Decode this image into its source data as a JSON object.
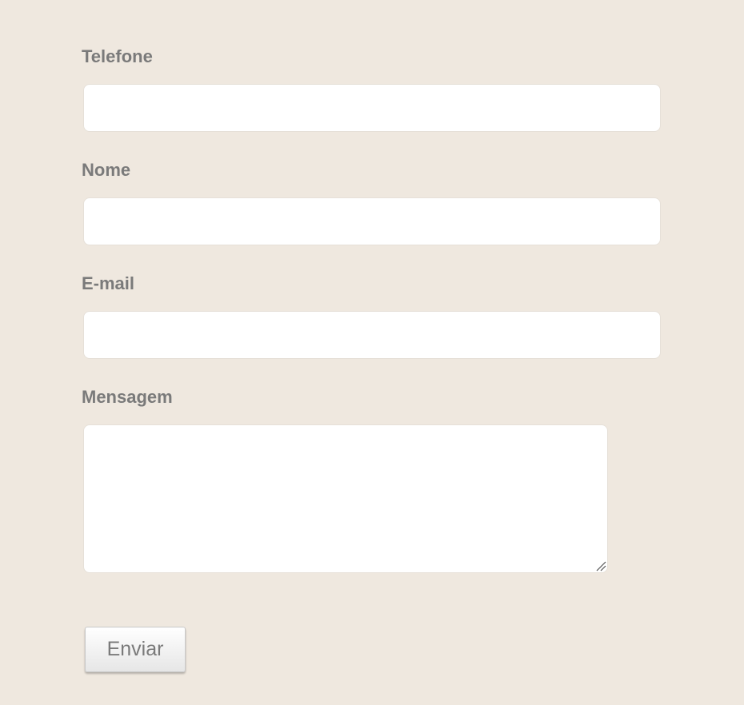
{
  "form": {
    "fields": [
      {
        "label": "Telefone",
        "value": ""
      },
      {
        "label": "Nome",
        "value": ""
      },
      {
        "label": "E-mail",
        "value": ""
      },
      {
        "label": "Mensagem",
        "value": ""
      }
    ],
    "submit_label": "Enviar"
  },
  "colors": {
    "background": "#efe8df",
    "label_text": "#7a7a7a",
    "field_background": "#ffffff"
  }
}
